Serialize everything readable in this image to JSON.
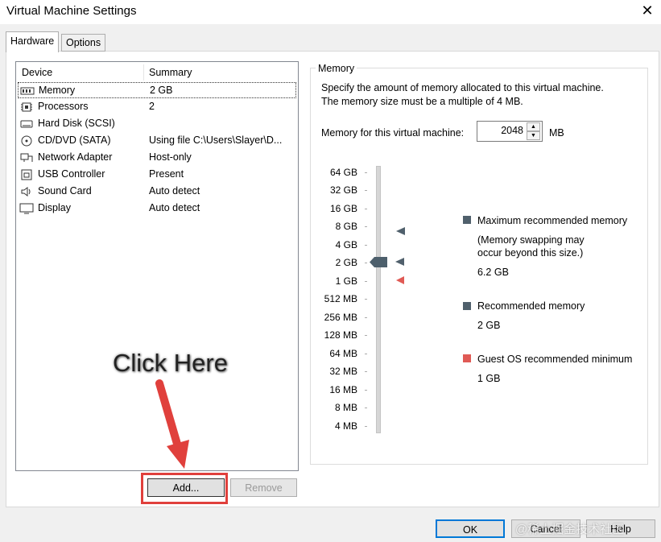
{
  "window": {
    "title": "Virtual Machine Settings",
    "close_label": "✕"
  },
  "tabs": [
    {
      "label": "Hardware"
    },
    {
      "label": "Options"
    }
  ],
  "device_list": {
    "columns": [
      "Device",
      "Summary"
    ],
    "rows": [
      {
        "icon": "memory-icon",
        "name": "Memory",
        "summary": "2 GB"
      },
      {
        "icon": "processor-icon",
        "name": "Processors",
        "summary": "2"
      },
      {
        "icon": "hard-disk-icon",
        "name": "Hard Disk (SCSI)",
        "summary": ""
      },
      {
        "icon": "cd-dvd-icon",
        "name": "CD/DVD (SATA)",
        "summary": "Using file C:\\Users\\Slayer\\D..."
      },
      {
        "icon": "network-adapter-icon",
        "name": "Network Adapter",
        "summary": "Host-only"
      },
      {
        "icon": "usb-icon",
        "name": "USB Controller",
        "summary": "Present"
      },
      {
        "icon": "speaker-icon",
        "name": "Sound Card",
        "summary": "Auto detect"
      },
      {
        "icon": "monitor-icon",
        "name": "Display",
        "summary": "Auto detect"
      }
    ]
  },
  "buttons": {
    "add": "Add...",
    "remove": "Remove",
    "ok": "OK",
    "cancel": "Cancel",
    "help": "Help"
  },
  "memory": {
    "legend": "Memory",
    "description_line1": "Specify the amount of memory allocated to this virtual machine.",
    "description_line2": "The memory size must be a multiple of 4 MB.",
    "field_label": "Memory for this virtual machine:",
    "value": "2048",
    "unit": "MB",
    "scale_labels": [
      "64 GB",
      "32 GB",
      "16 GB",
      "8 GB",
      "4 GB",
      "2 GB",
      "1 GB",
      "512 MB",
      "256 MB",
      "128 MB",
      "64 MB",
      "32 MB",
      "16 MB",
      "8 MB",
      "4 MB"
    ],
    "legend_items": {
      "max_title": "Maximum recommended memory",
      "max_note_line1": "(Memory swapping may",
      "max_note_line2": "occur beyond this size.)",
      "max_value": "6.2 GB",
      "rec_title": "Recommended memory",
      "rec_value": "2 GB",
      "min_title": "Guest OS recommended minimum",
      "min_value": "1 GB"
    },
    "colors": {
      "max": "#50606c",
      "recommended": "#50606c",
      "minimum": "#e05a55"
    }
  },
  "annotation": {
    "text": "Click Here",
    "color": "#e0403c"
  },
  "watermark": "@稀土掘金技术社区"
}
